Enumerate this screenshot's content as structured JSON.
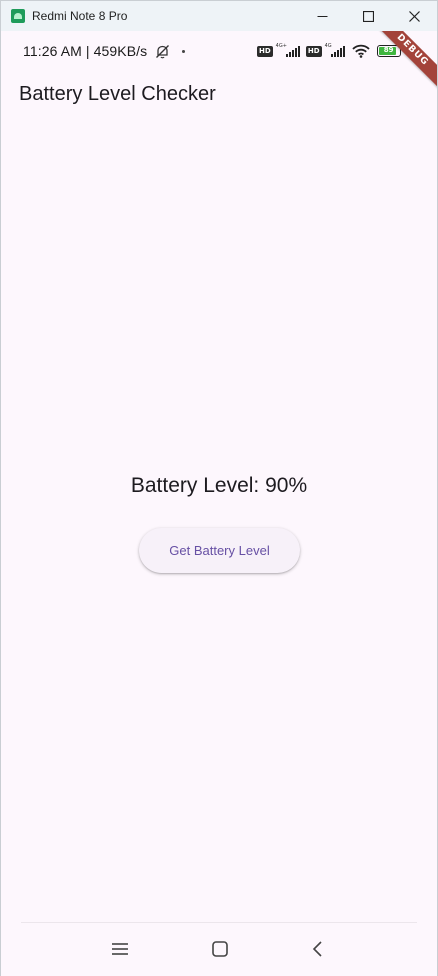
{
  "window": {
    "title": "Redmi Note 8 Pro",
    "minimize_icon": "minimize-icon",
    "maximize_icon": "maximize-icon",
    "close_icon": "close-icon"
  },
  "status_bar": {
    "time_speed": "11:26 AM | 459KB/s",
    "sim1_badge": "HD",
    "sim1_network": "4G+",
    "sim2_badge": "HD",
    "sim2_network": "4G",
    "battery_percent": "89",
    "battery_level": 0.89
  },
  "debug_banner": "DEBUG",
  "app_bar": {
    "title": "Battery Level Checker"
  },
  "body": {
    "battery_text": "Battery Level: 90%",
    "button_label": "Get Battery Level"
  },
  "colors": {
    "background": "#fdf7fd",
    "button_text": "#6750a4",
    "debug_banner": "#a3433a",
    "battery_fill": "#3fb53f"
  },
  "nav_bar": {
    "icons": [
      "menu-icon",
      "home-icon",
      "back-icon"
    ]
  }
}
